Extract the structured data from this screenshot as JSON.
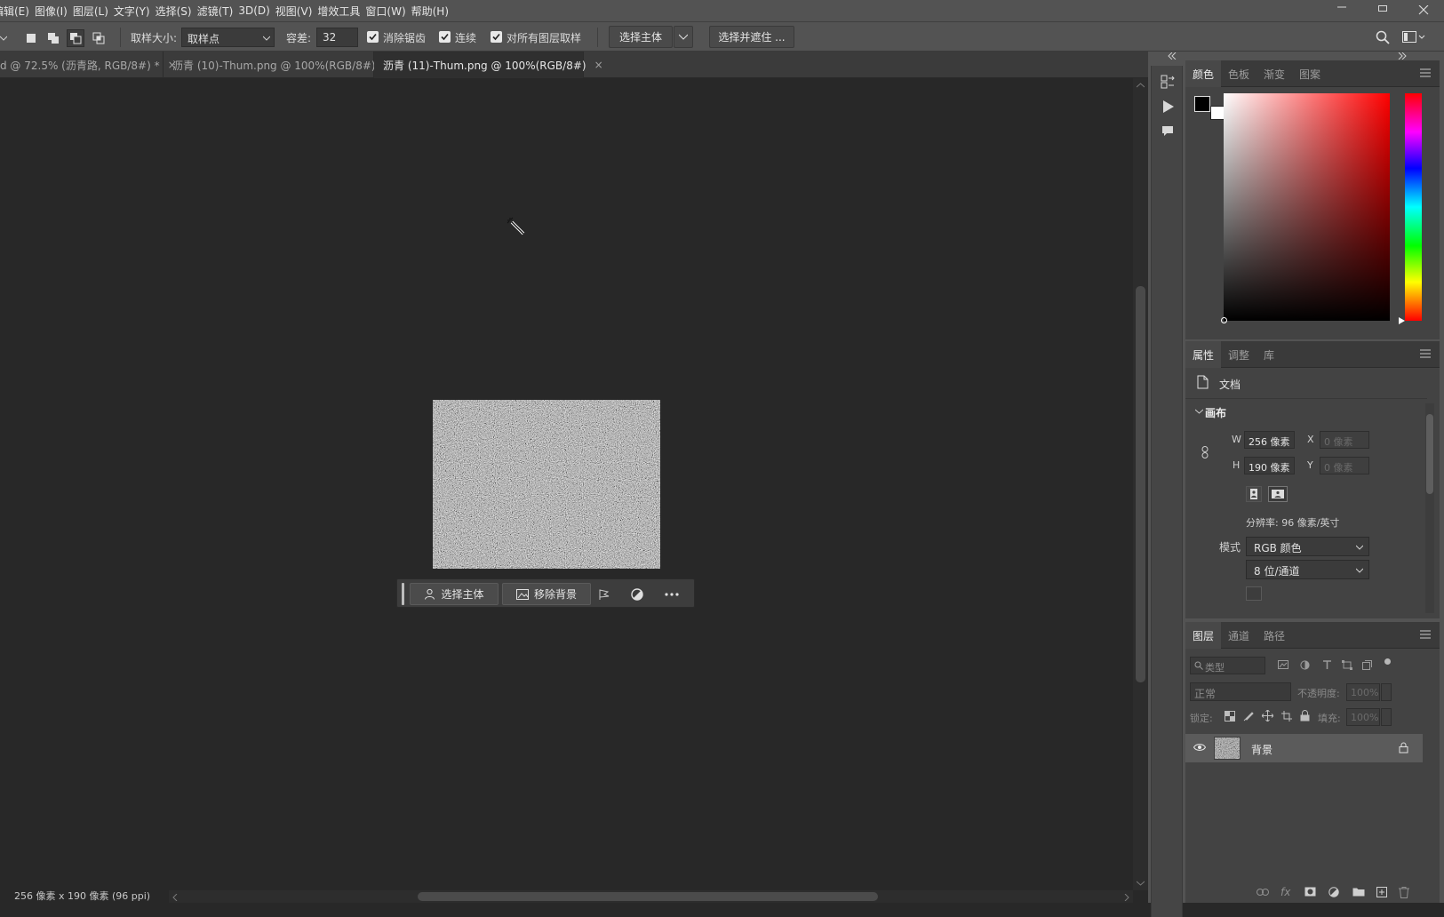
{
  "menu": {
    "items": [
      "编辑(E)",
      "图像(I)",
      "图层(L)",
      "文字(Y)",
      "选择(S)",
      "滤镜(T)",
      "3D(D)",
      "视图(V)",
      "增效工具",
      "窗口(W)",
      "帮助(H)"
    ]
  },
  "options": {
    "sample_size_label": "取样大小:",
    "sample_size_value": "取样点",
    "tolerance_label": "容差:",
    "tolerance_value": "32",
    "antialias_label": "消除锯齿",
    "contiguous_label": "连续",
    "all_layers_label": "对所有图层取样",
    "select_subject_label": "选择主体",
    "select_mask_label": "选择并遮住 ..."
  },
  "tabs": [
    {
      "label": "d @ 72.5% (沥青路, RGB/8#) *",
      "close": "×",
      "active": false
    },
    {
      "label": "沥青 (10)-Thum.png @ 100%(RGB/8#)",
      "close": "×",
      "active": false
    },
    {
      "label": "沥青 (11)-Thum.png @ 100%(RGB/8#)",
      "close": "×",
      "active": true
    }
  ],
  "context_bar": {
    "select_subject": "选择主体",
    "remove_background": "移除背景"
  },
  "status": {
    "text": "256 像素 x 190 像素 (96 ppi)",
    "arrow": "›"
  },
  "color_panel": {
    "tabs": [
      "颜色",
      "色板",
      "渐变",
      "图案"
    ],
    "foreground": "#000000",
    "background": "#ffffff",
    "hue": "#ff0000"
  },
  "properties_panel": {
    "tabs": [
      "属性",
      "调整",
      "库"
    ],
    "doc_label": "文档",
    "canvas_section": "画布",
    "w_label": "W",
    "w_value": "256 像素",
    "h_label": "H",
    "h_value": "190 像素",
    "x_label": "X",
    "x_placeholder": "0 像素",
    "y_label": "Y",
    "y_placeholder": "0 像素",
    "resolution": "分辨率: 96 像素/英寸",
    "mode_label": "模式",
    "mode_value": "RGB 颜色",
    "depth_value": "8 位/通道"
  },
  "layers_panel": {
    "tabs": [
      "图层",
      "通道",
      "路径"
    ],
    "filter_placeholder": "类型",
    "blend_mode": "正常",
    "opacity_label": "不透明度:",
    "opacity_value": "100%",
    "lock_label": "锁定:",
    "fill_label": "填充:",
    "fill_value": "100%",
    "layers": [
      {
        "name": "背景",
        "visible": true,
        "locked": true
      }
    ]
  }
}
